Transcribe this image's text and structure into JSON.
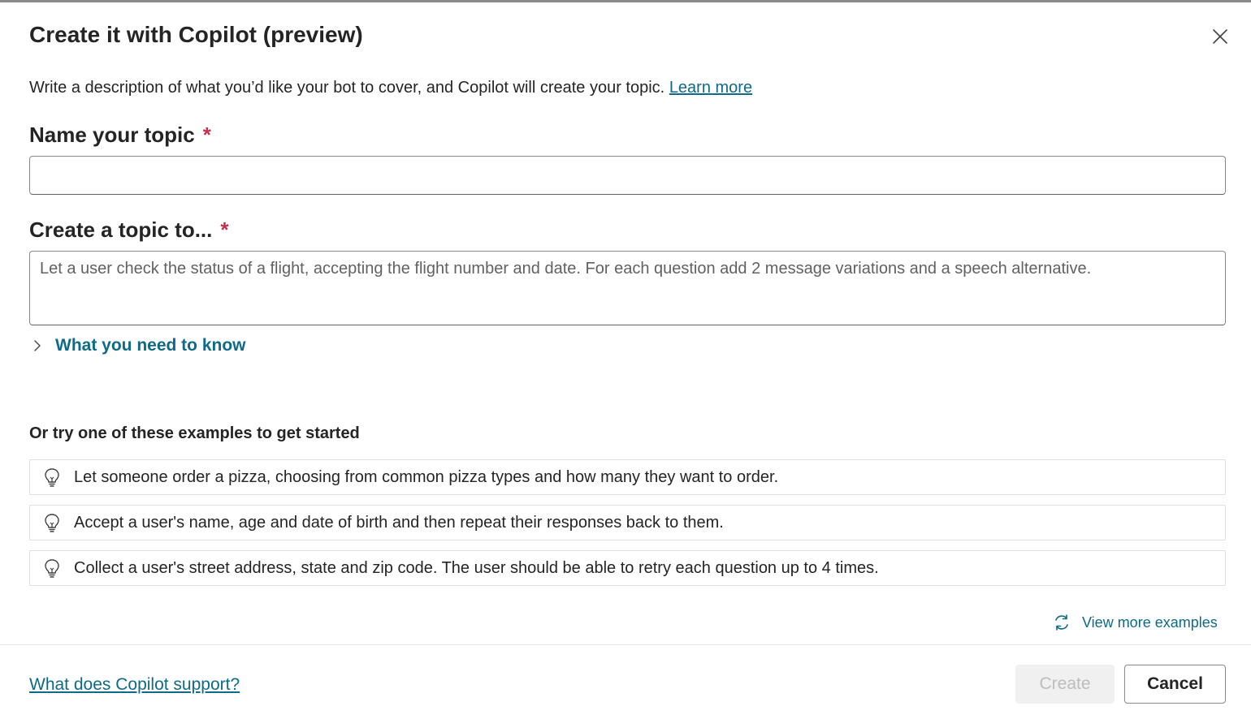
{
  "dialog": {
    "title": "Create it with Copilot (preview)",
    "description": "Write a description of what you’d like your bot to cover, and Copilot will create your topic.",
    "learn_more": "Learn more",
    "close_icon": "close-icon"
  },
  "name_field": {
    "label": "Name your topic",
    "required_mark": "*",
    "value": "",
    "placeholder": ""
  },
  "topic_field": {
    "label": "Create a topic to...",
    "required_mark": "*",
    "value": "",
    "placeholder": "Let a user check the status of a flight, accepting the flight number and date. For each question add 2 message variations and a speech alternative."
  },
  "need_to_know": {
    "label": "What you need to know",
    "icon": "chevron-right-icon"
  },
  "examples": {
    "heading": "Or try one of these examples to get started",
    "icon": "lightbulb-icon",
    "items": [
      {
        "text": "Let someone order a pizza, choosing from common pizza types and how many they want to order."
      },
      {
        "text": "Accept a user's name, age and date of birth and then repeat their responses back to them."
      },
      {
        "text": "Collect a user's street address, state and zip code. The user should be able to retry each question up to 4 times."
      }
    ],
    "view_more": "View more examples",
    "view_more_icon": "refresh-icon"
  },
  "footer": {
    "support_link": "What does Copilot support?",
    "create_label": "Create",
    "cancel_label": "Cancel"
  },
  "colors": {
    "link": "#0e6a88",
    "required": "#c4314b",
    "disabled_button_bg": "#f0f0f0",
    "disabled_button_text": "#bdbdbd"
  }
}
